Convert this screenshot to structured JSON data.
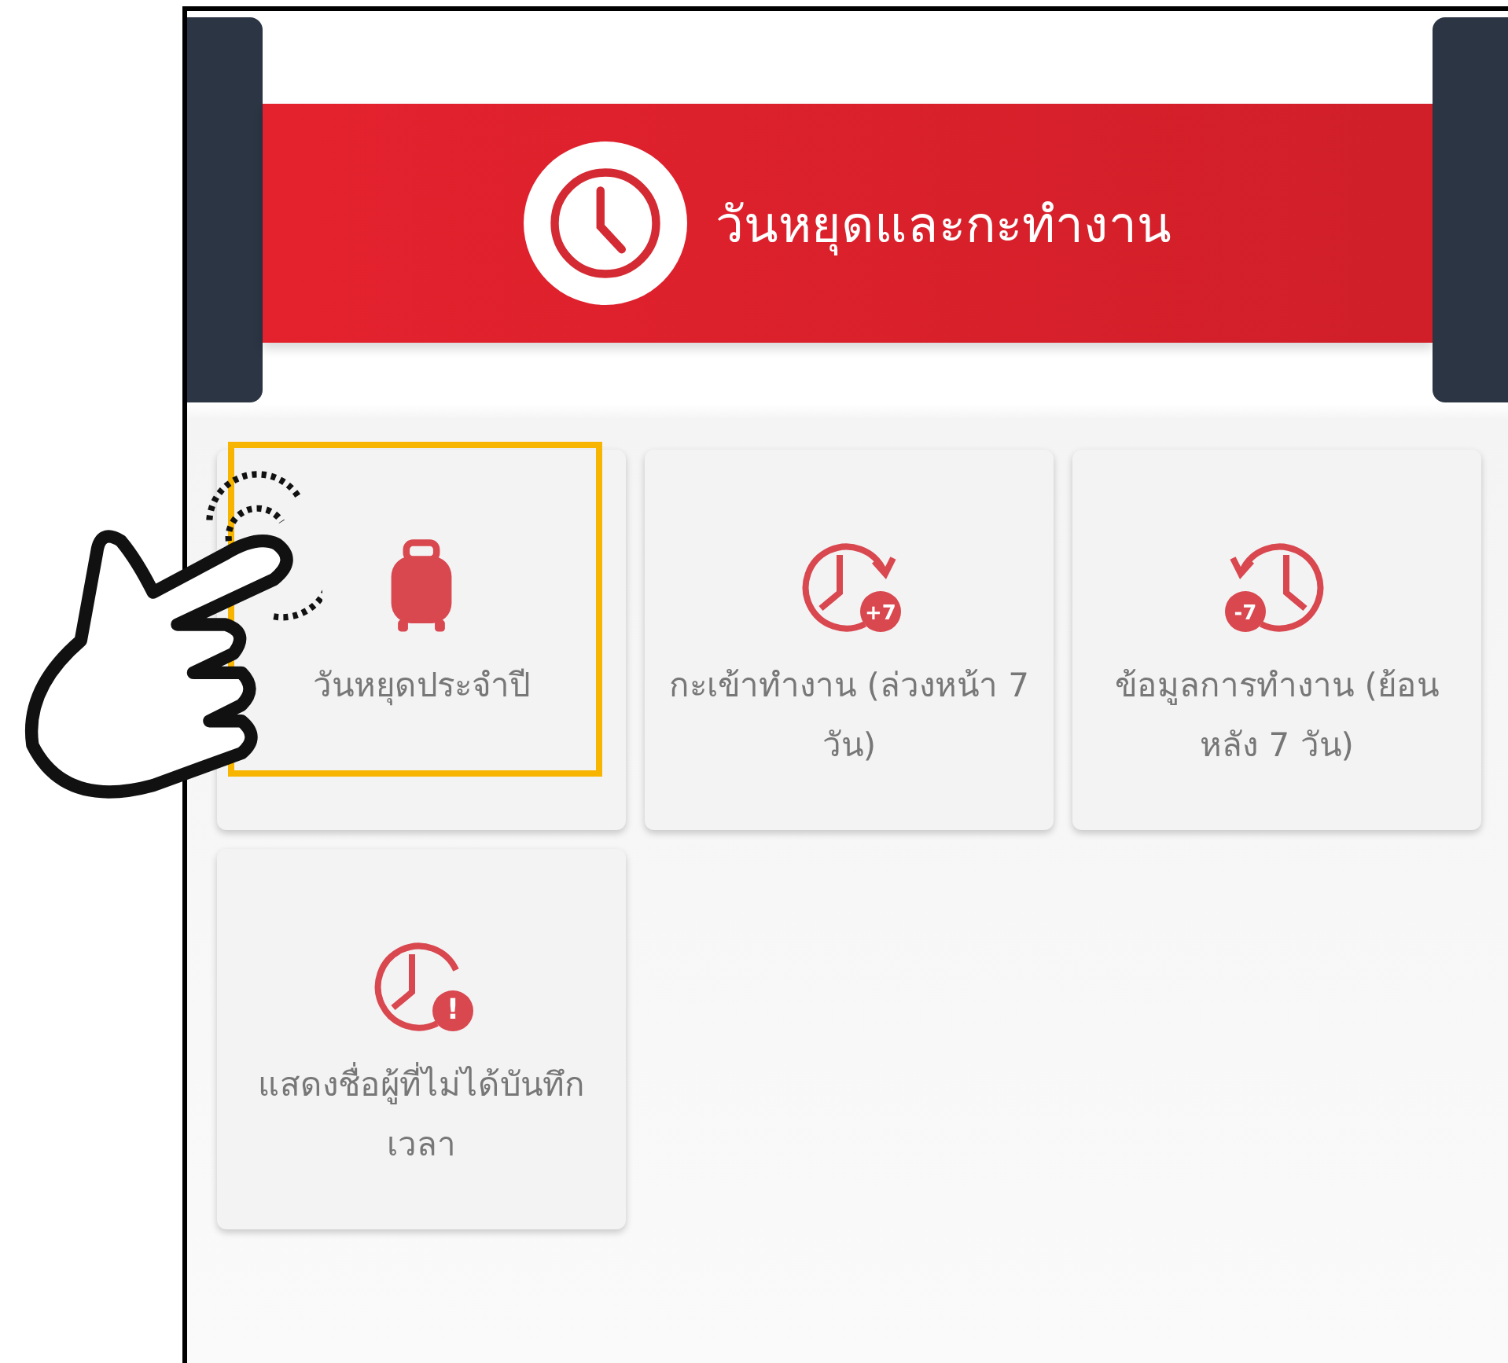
{
  "header": {
    "title": "วันหยุดและกะทำงาน"
  },
  "tiles": [
    {
      "kind": "luggage",
      "label": "วันหยุดประจำปี",
      "selected": true
    },
    {
      "kind": "clock-forward",
      "label": "กะเข้าทำงาน (ล่วงหน้า 7 วัน)",
      "badge": "+7",
      "selected": false
    },
    {
      "kind": "clock-back",
      "label": "ข้อมูลการทำงาน (ย้อนหลัง 7 วัน)",
      "badge": "-7",
      "selected": false
    },
    {
      "kind": "clock-alert",
      "label": "แสดงชื่อผู้ที่ไม่ได้บันทึกเวลา",
      "badge": "!",
      "selected": false
    }
  ]
}
